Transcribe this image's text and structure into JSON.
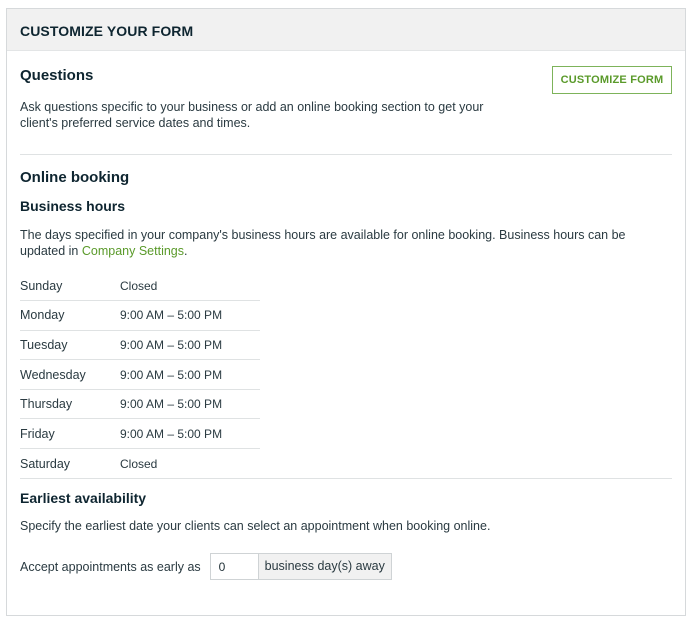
{
  "card": {
    "title": "CUSTOMIZE YOUR FORM"
  },
  "questions": {
    "title": "Questions",
    "description": "Ask questions specific to your business or add an online booking section to get your client's preferred service dates and times.",
    "customize_button": "CUSTOMIZE FORM"
  },
  "online_booking": {
    "title": "Online booking",
    "business_hours": {
      "title": "Business hours",
      "description": "The days specified in your company's business hours are available for online booking. Business hours can be updated in ",
      "link": "Company Settings",
      "description_end": ".",
      "days": [
        {
          "day": "Sunday",
          "hours": "Closed"
        },
        {
          "day": "Monday",
          "hours": "9:00 AM – 5:00 PM"
        },
        {
          "day": "Tuesday",
          "hours": "9:00 AM – 5:00 PM"
        },
        {
          "day": "Wednesday",
          "hours": "9:00 AM – 5:00 PM"
        },
        {
          "day": "Thursday",
          "hours": "9:00 AM – 5:00 PM"
        },
        {
          "day": "Friday",
          "hours": "9:00 AM – 5:00 PM"
        },
        {
          "day": "Saturday",
          "hours": "Closed"
        }
      ]
    },
    "earliest_availability": {
      "title": "Earliest availability",
      "description": "Specify the earliest date your clients can select an appointment when booking online.",
      "label": "Accept appointments as early as",
      "value": "0",
      "unit": "business day(s) away"
    }
  },
  "colors": {
    "accent": "#5a9a2a",
    "header_bg": "#f1f1f1",
    "heading": "#0e2530"
  }
}
